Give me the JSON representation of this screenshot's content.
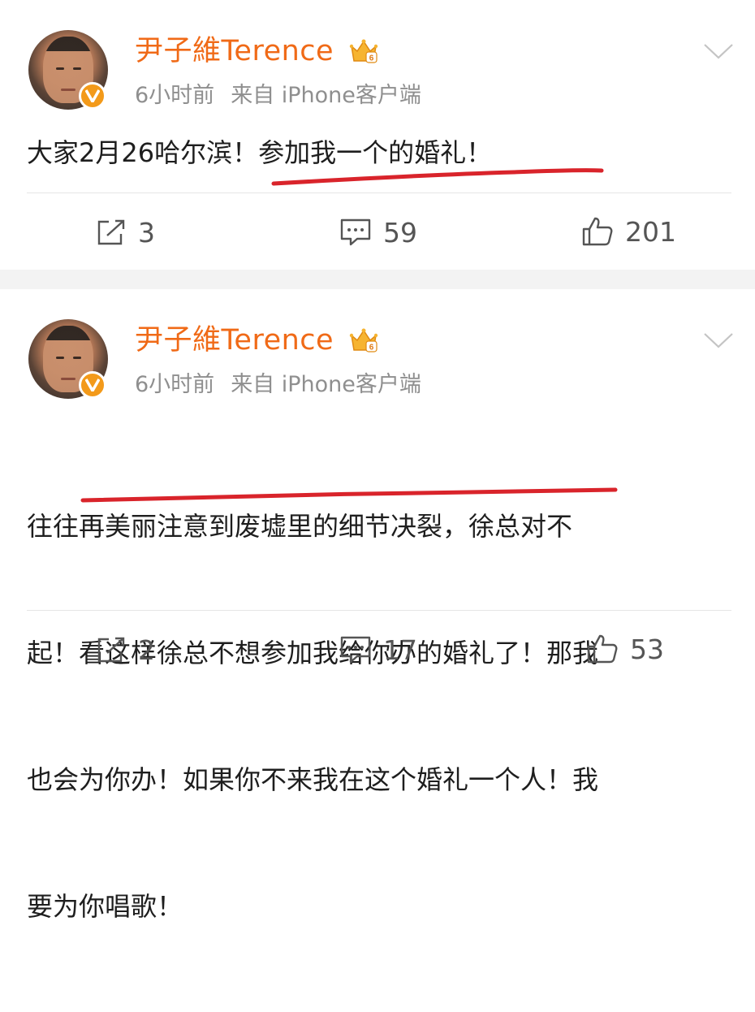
{
  "posts": [
    {
      "username": "尹子維Terence",
      "time": "6小时前",
      "source": "来自 iPhone客户端",
      "content": "大家2月26哈尔滨！参加我一个的婚礼！",
      "actions": {
        "repost": "3",
        "comment": "59",
        "like": "201"
      }
    },
    {
      "username": "尹子維Terence",
      "time": "6小时前",
      "source": "来自 iPhone客户端",
      "content_lines": [
        "往往再美丽注意到废墟里的细节决裂，徐总对不",
        "起！看这样徐总不想参加我给你办的婚礼了！那我",
        "也会为你办！如果你不来我在这个婚礼一个人！我",
        "要为你唱歌！"
      ],
      "actions": {
        "repost": "2",
        "comment": "17",
        "like": "53"
      }
    }
  ],
  "colors": {
    "username": "#f06a17",
    "meta": "#8f8f8f",
    "underline": "#d9242b",
    "verified_badge": "#f39a1a",
    "separator": "#f3f3f3"
  },
  "icons": [
    "verified-v-icon",
    "crown-vip-icon",
    "chevron-down-icon",
    "repost-icon",
    "comment-icon",
    "like-icon"
  ]
}
